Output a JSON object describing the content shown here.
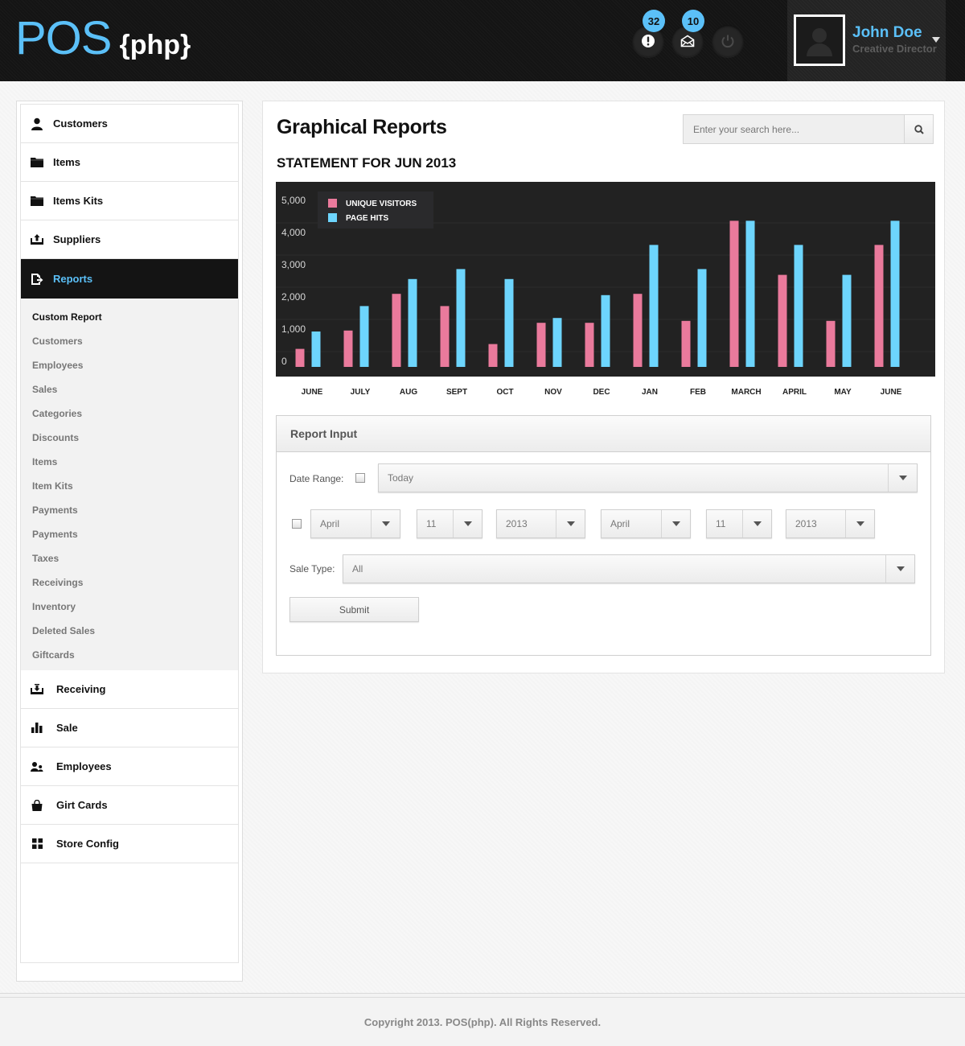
{
  "header": {
    "logo_main": "POS",
    "logo_sub": "{php}",
    "notifications": {
      "icon": "alert-icon",
      "count": "32"
    },
    "messages": {
      "icon": "envelope-icon",
      "count": "10"
    },
    "power": {
      "icon": "power-icon"
    },
    "user": {
      "name": "John Doe",
      "role": "Creative Director"
    }
  },
  "sidebar": {
    "top_items": [
      {
        "label": "Customers",
        "icon": "user-icon"
      },
      {
        "label": "Items",
        "icon": "folder-icon"
      },
      {
        "label": "Items Kits",
        "icon": "folder-icon"
      },
      {
        "label": "Suppliers",
        "icon": "upload-tray-icon"
      },
      {
        "label": "Reports",
        "icon": "report-export-icon",
        "active": true
      }
    ],
    "submenu": [
      {
        "label": "Custom Report",
        "current": true
      },
      {
        "label": "Customers"
      },
      {
        "label": "Employees"
      },
      {
        "label": "Sales"
      },
      {
        "label": "Categories"
      },
      {
        "label": "Discounts"
      },
      {
        "label": "Items"
      },
      {
        "label": "Item Kits"
      },
      {
        "label": "Payments"
      },
      {
        "label": "Payments"
      },
      {
        "label": "Taxes"
      },
      {
        "label": "Receivings"
      },
      {
        "label": "Inventory"
      },
      {
        "label": "Deleted Sales"
      },
      {
        "label": "Giftcards"
      }
    ],
    "bottom_items": [
      {
        "label": "Receiving",
        "icon": "download-tray-icon"
      },
      {
        "label": "Sale",
        "icon": "bar-chart-icon"
      },
      {
        "label": "Employees",
        "icon": "users-icon"
      },
      {
        "label": "Girt Cards",
        "icon": "shopping-bag-icon"
      },
      {
        "label": "Store Config",
        "icon": "grid-icon"
      }
    ]
  },
  "main": {
    "title": "Graphical Reports",
    "search": {
      "placeholder": "Enter your search here...",
      "value": ""
    },
    "subtitle": "STATEMENT FOR JUN 2013"
  },
  "chart_data": {
    "type": "bar",
    "title": "STATEMENT FOR JUN 2013",
    "xlabel": "",
    "ylabel": "",
    "categories": [
      "JUNE",
      "JULY",
      "AUG",
      "SEPT",
      "OCT",
      "NOV",
      "DEC",
      "JAN",
      "FEB",
      "MARCH",
      "APRIL",
      "MAY",
      "JUNE"
    ],
    "series": [
      {
        "name": "UNIQUE VISITORS",
        "color": "#ea7a9c",
        "values": [
          560,
          1130,
          2270,
          1890,
          710,
          1370,
          1370,
          2270,
          1430,
          4540,
          2860,
          1430,
          3790
        ]
      },
      {
        "name": "PAGE HITS",
        "color": "#6dd5fd",
        "values": [
          1100,
          1890,
          2730,
          3040,
          2730,
          1520,
          2230,
          3790,
          3040,
          4540,
          3790,
          2860,
          4540
        ]
      }
    ],
    "ylim": [
      0,
      5000
    ],
    "yticks": [
      "0",
      "1,000",
      "2,000",
      "3,000",
      "4,000",
      "5,000"
    ],
    "ytick_values": [
      0,
      1000,
      2000,
      3000,
      4000,
      5000
    ],
    "grid": true,
    "legend": "top-left",
    "background": "#222222"
  },
  "report_input": {
    "title": "Report Input",
    "date_range_label": "Date Range:",
    "date_range_value": "Today",
    "from": {
      "month": "April",
      "day": "11",
      "year": "2013"
    },
    "to": {
      "month": "April",
      "day": "11",
      "year": "2013"
    },
    "sale_type_label": "Sale Type:",
    "sale_type_value": "All",
    "submit_label": "Submit"
  },
  "footer": {
    "text": "Copyright 2013. POS(php). All Rights Reserved."
  },
  "colors": {
    "accent": "#5bc0f8",
    "header_bg": "#141414",
    "active_nav_bg": "#141414"
  }
}
